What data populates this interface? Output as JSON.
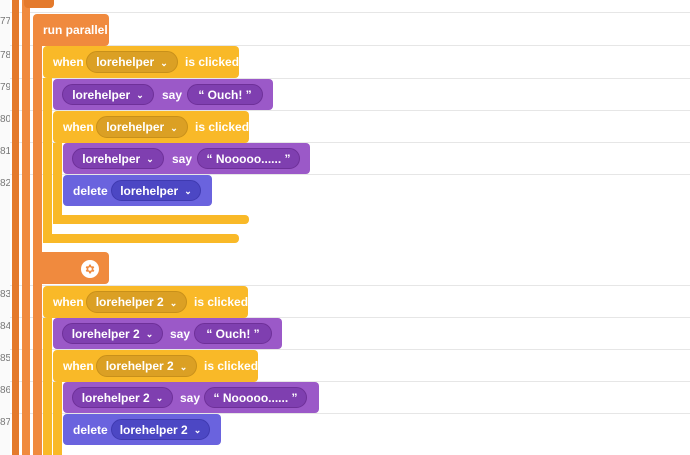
{
  "line_numbers": [
    "77",
    "78",
    "79",
    "80",
    "81",
    "82",
    "83",
    "84",
    "85",
    "86",
    "87"
  ],
  "run_parallel": {
    "label": "run parallel"
  },
  "group1": {
    "when1": {
      "when": "when",
      "sprite": "lorehelper",
      "event": "is clicked"
    },
    "say1": {
      "sprite": "lorehelper",
      "say": "say",
      "text": "“ Ouch! ”"
    },
    "when2": {
      "when": "when",
      "sprite": "lorehelper",
      "event": "is clicked"
    },
    "say2": {
      "sprite": "lorehelper",
      "say": "say",
      "text": "“ Nooooo...... ”"
    },
    "delete1": {
      "delete": "delete",
      "sprite": "lorehelper"
    }
  },
  "group2": {
    "when1": {
      "when": "when",
      "sprite": "lorehelper 2",
      "event": "is clicked"
    },
    "say1": {
      "sprite": "lorehelper 2",
      "say": "say",
      "text": "“ Ouch! ”"
    },
    "when2": {
      "when": "when",
      "sprite": "lorehelper 2",
      "event": "is clicked"
    },
    "say2": {
      "sprite": "lorehelper 2",
      "say": "say",
      "text": "“ Nooooo...... ”"
    },
    "delete1": {
      "delete": "delete",
      "sprite": "lorehelper 2"
    }
  },
  "icons": {
    "chevron": "chevron-down-icon",
    "gear": "gear-icon"
  }
}
